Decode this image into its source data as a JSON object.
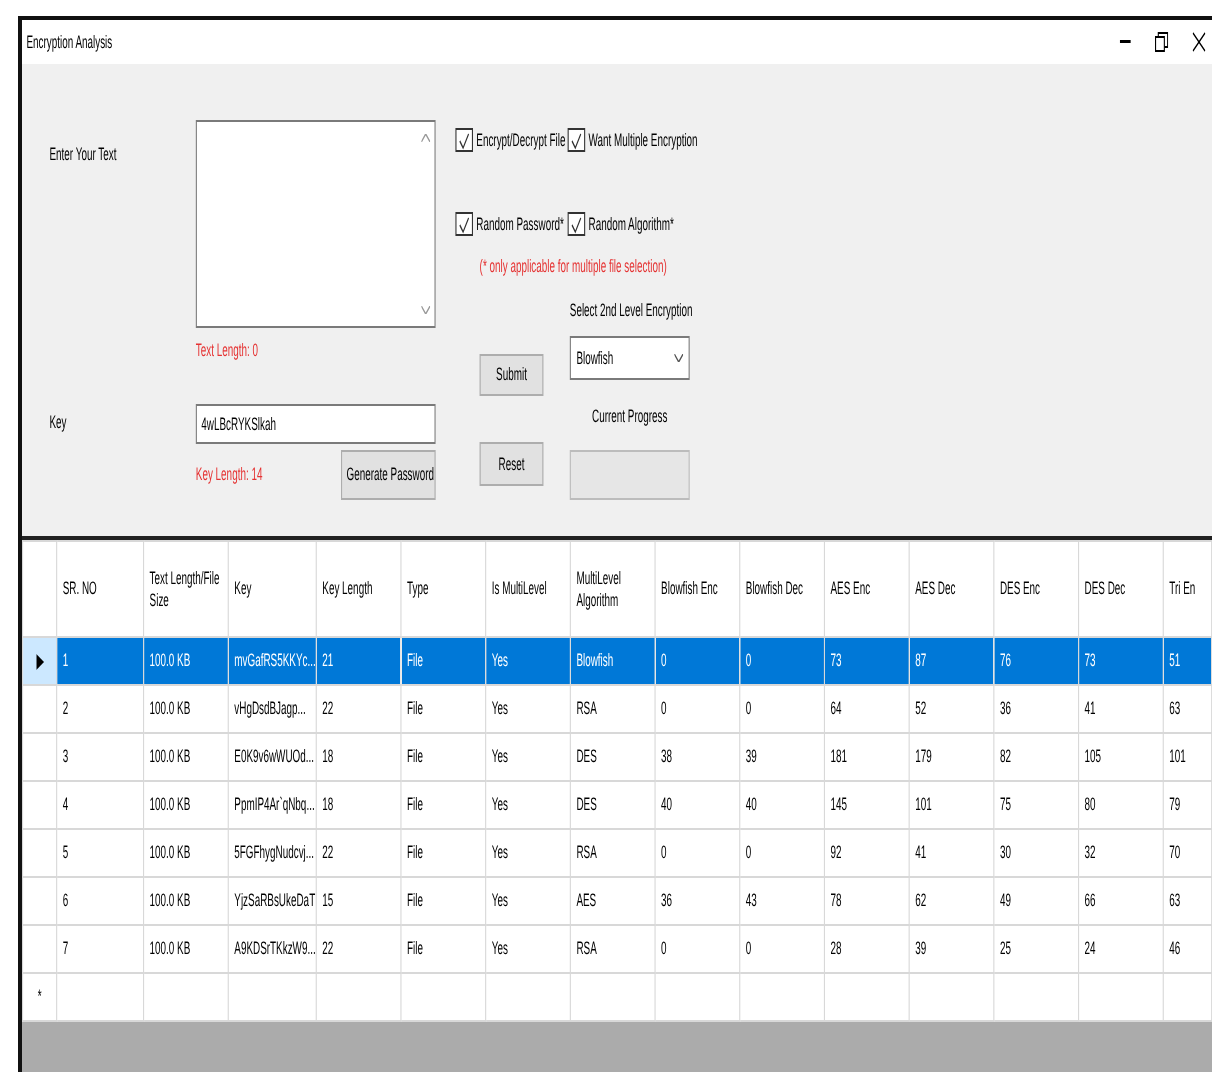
{
  "window": {
    "title": "Encryption Analysis"
  },
  "form": {
    "text_label": "Enter Your Text",
    "text_length": "Text Length: 0",
    "key_label": "Key",
    "key_field": {
      "value": "4wLBcRYKSlkah"
    },
    "key_length": "Key Length: 14",
    "generate_button": "Generate Password",
    "options": [
      {
        "label": "Encrypt/Decrypt File",
        "checked": true
      },
      {
        "label": "Want Multiple Encryption",
        "checked": true
      },
      {
        "label": "Random Password*",
        "checked": true
      },
      {
        "label": "Random Algorithm*",
        "checked": true
      }
    ],
    "note": "(* only applicable for multiple file selection)",
    "submit_button": "Submit",
    "reset_button": "Reset",
    "level2_label": "Select 2nd Level Encryption",
    "level2_select": {
      "value": "Blowfish"
    },
    "progress_label": "Current Progress",
    "progress": {
      "level": 0
    }
  },
  "table": {
    "columns": [
      "SR. NO",
      "Text Length/File Size",
      "Key",
      "Key Length",
      "Type",
      "Is MultiLevel",
      "MultiLevel Algorithm",
      "Blowfish Enc",
      "Blowfish Dec",
      "AES Enc",
      "AES Dec",
      "DES Enc",
      "DES Dec",
      "Tri En"
    ],
    "rows": [
      {
        "selected": true,
        "cells": [
          "1",
          "100.0 KB",
          "mvGafRS5KKYc...",
          "21",
          "File",
          "Yes",
          "Blowfish",
          "0",
          "0",
          "73",
          "87",
          "76",
          "73",
          "51"
        ]
      },
      {
        "selected": false,
        "cells": [
          "2",
          "100.0 KB",
          "vHgDsdBJagp...",
          "22",
          "File",
          "Yes",
          "RSA",
          "0",
          "0",
          "64",
          "52",
          "36",
          "41",
          "63"
        ]
      },
      {
        "selected": false,
        "cells": [
          "3",
          "100.0 KB",
          "E0K9v6wWUOd...",
          "18",
          "File",
          "Yes",
          "DES",
          "38",
          "39",
          "181",
          "179",
          "82",
          "105",
          "101"
        ]
      },
      {
        "selected": false,
        "cells": [
          "4",
          "100.0 KB",
          "PpmIP4Ar`qNbq...",
          "18",
          "File",
          "Yes",
          "DES",
          "40",
          "40",
          "145",
          "101",
          "75",
          "80",
          "79"
        ]
      },
      {
        "selected": false,
        "cells": [
          "5",
          "100.0 KB",
          "5FGFhygNudcvj...",
          "22",
          "File",
          "Yes",
          "RSA",
          "0",
          "0",
          "92",
          "41",
          "30",
          "32",
          "70"
        ]
      },
      {
        "selected": false,
        "cells": [
          "6",
          "100.0 KB",
          "YjzSaRBsUkeDaT",
          "15",
          "File",
          "Yes",
          "AES",
          "36",
          "43",
          "78",
          "62",
          "49",
          "66",
          "63"
        ]
      },
      {
        "selected": false,
        "cells": [
          "7",
          "100.0 KB",
          "A9KDSrTKkzW9...",
          "22",
          "File",
          "Yes",
          "RSA",
          "0",
          "0",
          "28",
          "39",
          "25",
          "24",
          "46"
        ]
      }
    ],
    "new_row_marker": "*"
  }
}
